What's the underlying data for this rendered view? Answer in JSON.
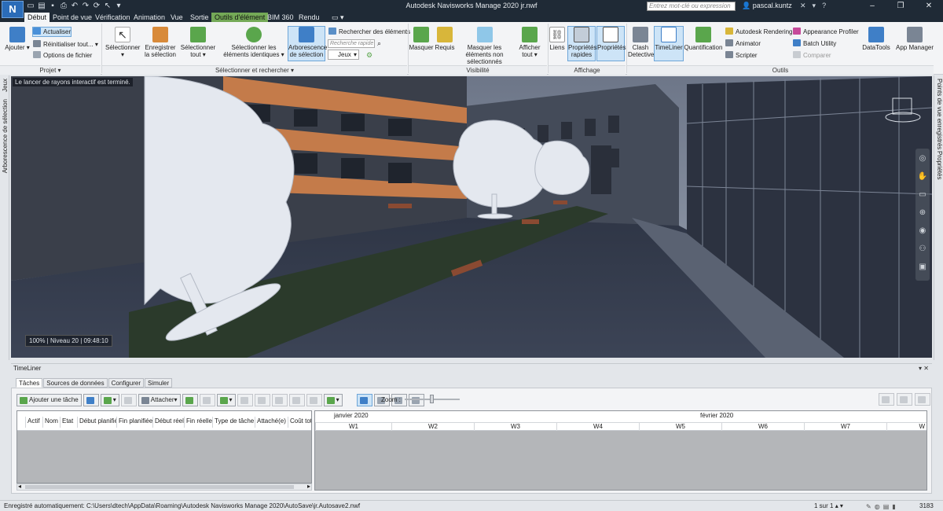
{
  "app": {
    "logo": "N",
    "title": "Autodesk Navisworks Manage 2020   jr.nwf",
    "search_placeholder": "Entrez mot-clé ou expression",
    "user": "pascal.kuntz"
  },
  "tabs": [
    "Début",
    "Point de vue",
    "Vérification",
    "Animation",
    "Vue",
    "Sortie",
    "Outils d'élément",
    "BIM 360",
    "Rendu"
  ],
  "ribbon": {
    "projet": {
      "ajouter": "Ajouter",
      "actualiser": "Actualiser",
      "reinit": "Réinitialiser tout...",
      "options": "Options de fichier",
      "panel": "Projet"
    },
    "selection": {
      "selectionner": "Sélectionner",
      "enregistrer": "Enregistrer la sélection",
      "tout": "Sélectionner tout",
      "identiques": "Sélectionner les éléments identiques",
      "arborescence": "Arborescence de sélection",
      "rechercher": "Rechercher des éléments",
      "quick_search": "Recherche rapide",
      "jeux": "Jeux",
      "panel": "Sélectionner et rechercher"
    },
    "visibilite": {
      "masquer": "Masquer",
      "requis": "Requis",
      "masquer_non": "Masquer les éléments non sélectionnés",
      "afficher": "Afficher tout",
      "panel": "Visibilité"
    },
    "affichage": {
      "liens": "Liens",
      "rapides": "Propriétés rapides",
      "proprietes": "Propriétés",
      "panel": "Affichage"
    },
    "outils": {
      "clash": "Clash Detective",
      "timeliner": "TimeLiner",
      "quantification": "Quantification",
      "rendering": "Autodesk Rendering",
      "animator": "Animator",
      "scripter": "Scripter",
      "appearance": "Appearance Profiler",
      "batch": "Batch Utility",
      "comparer": "Comparer",
      "datatools": "DataTools",
      "appmanager": "App Manager",
      "panel": "Outils"
    }
  },
  "side": {
    "left": [
      "Jeux",
      "Arborescence de sélection"
    ],
    "right": [
      "Points de vue enregistrés",
      "Propriétés"
    ]
  },
  "viewport": {
    "message": "Le lancer de rayons interactif est terminé.",
    "status": "100%  |  Niveau 20  |  09:48:10"
  },
  "timeliner": {
    "title": "TimeLiner",
    "tabs": [
      "Tâches",
      "Sources de données",
      "Configurer",
      "Simuler"
    ],
    "toolbar": {
      "add_task": "Ajouter une tâche",
      "attach": "Attacher",
      "zoom": "Zoom :"
    },
    "columns": [
      "Actif",
      "Nom",
      "Etat",
      "Début planifié",
      "Fin planifiée",
      "Début réel",
      "Fin réelle",
      "Type de tâche",
      "Attaché(e)",
      "Coût total"
    ],
    "months": [
      "janvier 2020",
      "février 2020"
    ],
    "weeks": [
      "W1",
      "W2",
      "W3",
      "W4",
      "W5",
      "W6",
      "W7",
      "W"
    ]
  },
  "statusbar": {
    "autosave": "Enregistré automatiquement: C:\\Users\\dtech\\AppData\\Roaming\\Autodesk Navisworks Manage 2020\\AutoSave\\jr.Autosave2.nwf",
    "page": "1 sur 1",
    "memory": "3183 MB"
  },
  "colors": {
    "accent": "#2b6cb8",
    "context_tab": "#74a957",
    "selected": "#cde4f7"
  }
}
